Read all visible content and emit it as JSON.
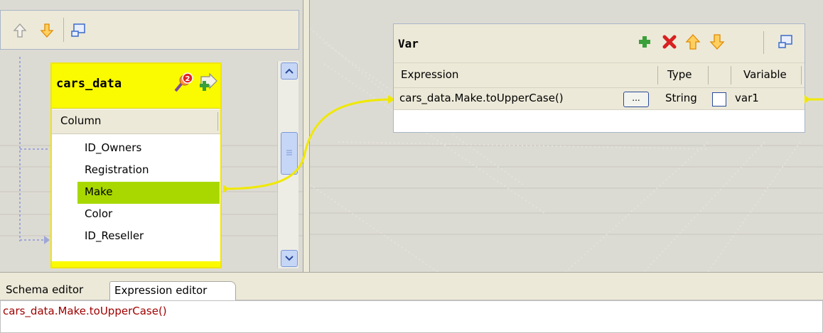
{
  "left_toolbar": {
    "icons": [
      "arrow-up-icon",
      "arrow-down-icon",
      "minimize-window-icon"
    ]
  },
  "input_table": {
    "title": "cars_data",
    "badge_count": "2",
    "column_header": "Column",
    "columns": [
      "ID_Owners",
      "Registration",
      "Make",
      "Color",
      "ID_Reseller"
    ],
    "selected_column": "Make"
  },
  "var_table": {
    "title": "Var",
    "headers": {
      "expression": "Expression",
      "type": "Type",
      "variable": "Variable"
    },
    "row": {
      "expression": "cars_data.Make.toUpperCase()",
      "button": "...",
      "type": "String",
      "nullable": false,
      "variable": "var1"
    },
    "icons": [
      "add-icon",
      "delete-icon",
      "arrow-up-icon",
      "arrow-down-icon",
      "minimize-window-icon"
    ]
  },
  "tabs": [
    "Schema editor",
    "Expression editor"
  ],
  "active_tab": "Expression editor",
  "editor": {
    "text": "cars_data.Make.toUpperCase()"
  },
  "colors": {
    "accent_yellow": "#fafa00",
    "selected_green": "#a8d800",
    "link_yellow": "#f0e800",
    "editor_text": "#a00000"
  }
}
